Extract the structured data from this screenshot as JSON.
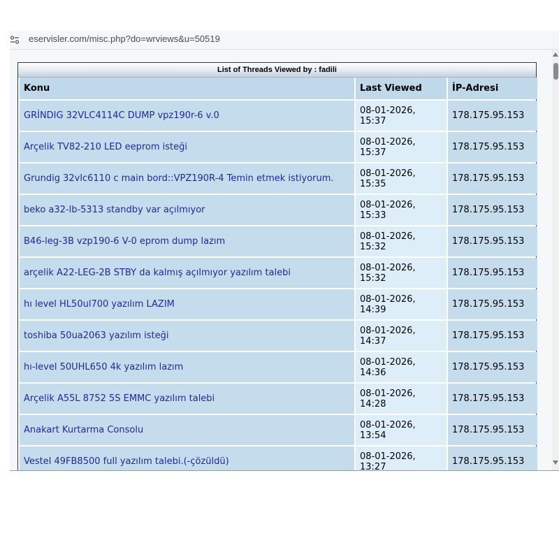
{
  "address_bar": {
    "url": "eservisler.com/misc.php?do=wrviews&u=50519"
  },
  "table": {
    "title": "List of Threads Viewed by : fadili",
    "headers": [
      "Konu",
      "Last Viewed",
      "İP-Adresi"
    ],
    "rows": [
      {
        "topic": "GRİNDIG 32VLC4114C DUMP vpz190r-6 v.0",
        "date": "08-01-2026,",
        "time": "15:37",
        "ip": "178.175.95.153"
      },
      {
        "topic": "Arçelik TV82-210 LED eeprom isteği",
        "date": "08-01-2026,",
        "time": "15:37",
        "ip": "178.175.95.153"
      },
      {
        "topic": "Grundig 32vlc6110 c main bord::VPZ190R-4 Temin etmek istiyorum.",
        "date": "08-01-2026,",
        "time": "15:35",
        "ip": "178.175.95.153"
      },
      {
        "topic": "beko a32-lb-5313 standby var açılmıyor",
        "date": "08-01-2026,",
        "time": "15:33",
        "ip": "178.175.95.153"
      },
      {
        "topic": "B46-leg-3B vzp190-6 V-0 eprom dump lazım",
        "date": "08-01-2026,",
        "time": "15:32",
        "ip": "178.175.95.153"
      },
      {
        "topic": "arçelik A22-LEG-2B STBY da kalmış açılmıyor yazılım talebi",
        "date": "08-01-2026,",
        "time": "15:32",
        "ip": "178.175.95.153"
      },
      {
        "topic": "hı level HL50ul700 yazılım LAZIM",
        "date": "08-01-2026,",
        "time": "14:39",
        "ip": "178.175.95.153"
      },
      {
        "topic": "toshiba 50ua2063 yazılım isteği",
        "date": "08-01-2026,",
        "time": "14:37",
        "ip": "178.175.95.153"
      },
      {
        "topic": "hı-level 50UHL650 4k yazılım lazım",
        "date": "08-01-2026,",
        "time": "14:36",
        "ip": "178.175.95.153"
      },
      {
        "topic": "Arçelik A55L 8752 5S EMMC yazılım talebi",
        "date": "08-01-2026,",
        "time": "14:28",
        "ip": "178.175.95.153"
      },
      {
        "topic": "Anakart Kurtarma Consolu",
        "date": "08-01-2026,",
        "time": "13:54",
        "ip": "178.175.95.153"
      },
      {
        "topic": "Vestel 49FB8500 full yazılım talebi.(-çözüldü)",
        "date": "08-01-2026,",
        "time": "13:27",
        "ip": "178.175.95.153"
      }
    ]
  },
  "colors": {
    "link": "#1f2a96",
    "header_bg": "#bfd9ea",
    "row_bg": "#c4dcec",
    "date_bg": "#deeef8",
    "border": "#1c2f9e"
  }
}
